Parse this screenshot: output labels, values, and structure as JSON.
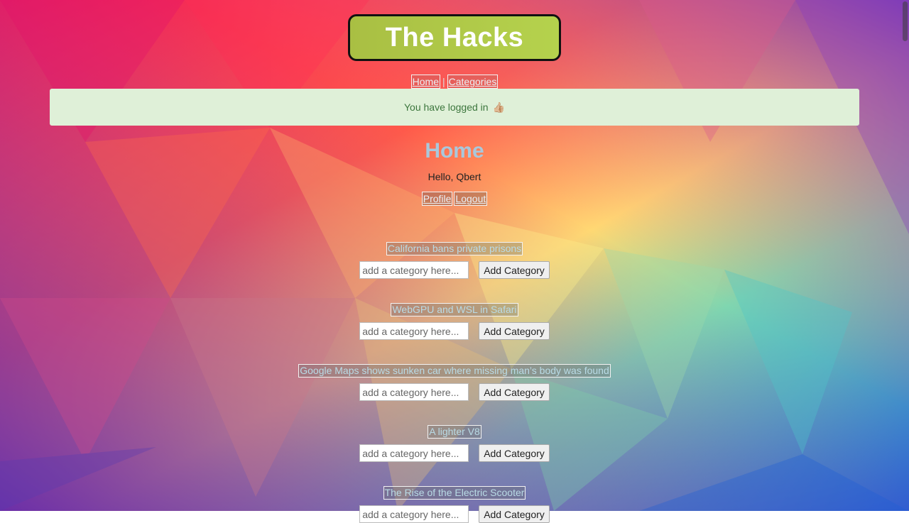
{
  "site": {
    "title": "The Hacks"
  },
  "nav": {
    "home": "Home",
    "separator": "|",
    "categories": "Categories"
  },
  "alert": {
    "message": "You have logged in",
    "emoji": "👍🏼"
  },
  "home": {
    "heading": "Home",
    "greeting": "Hello, Qbert",
    "profile_link": "Profile",
    "logout_link": "Logout"
  },
  "posts": [
    {
      "title": "California bans private prisons",
      "input_placeholder": "add a category here...",
      "button_label": "Add Category"
    },
    {
      "title": "WebGPU and WSL in Safari",
      "input_placeholder": "add a category here...",
      "button_label": "Add Category"
    },
    {
      "title": "Google Maps shows sunken car where missing man’s body was found",
      "input_placeholder": "add a category here...",
      "button_label": "Add Category"
    },
    {
      "title": "A lighter V8",
      "input_placeholder": "add a category here...",
      "button_label": "Add Category"
    },
    {
      "title": "The Rise of the Electric Scooter",
      "input_placeholder": "add a category here...",
      "button_label": "Add Category"
    }
  ]
}
